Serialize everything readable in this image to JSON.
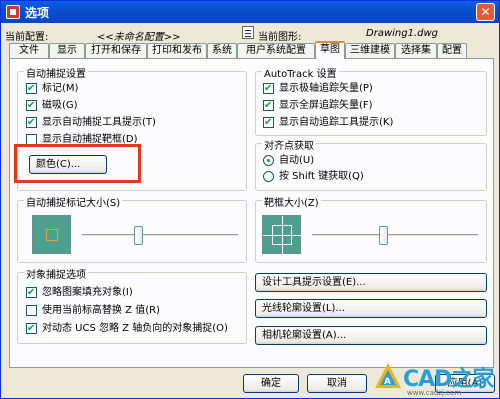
{
  "window": {
    "title": "选项",
    "close_glyph": "✕"
  },
  "config": {
    "current_config_label": "当前配置:",
    "current_config_value": "<<未命名配置>>",
    "current_drawing_label": "当前图形:",
    "current_drawing_value": "Drawing1.dwg"
  },
  "tabs": [
    {
      "label": "文件"
    },
    {
      "label": "显示"
    },
    {
      "label": "打开和保存"
    },
    {
      "label": "打印和发布"
    },
    {
      "label": "系统"
    },
    {
      "label": "用户系统配置"
    },
    {
      "label": "草图"
    },
    {
      "label": "三维建模"
    },
    {
      "label": "选择集"
    },
    {
      "label": "配置"
    }
  ],
  "autosnap": {
    "title": "自动捕捉设置",
    "options": [
      {
        "label": "标记(M)",
        "checked": true
      },
      {
        "label": "磁吸(G)",
        "checked": true
      },
      {
        "label": "显示自动捕捉工具提示(T)",
        "checked": true
      },
      {
        "label": "显示自动捕捉靶框(D)",
        "checked": false
      }
    ],
    "color_button": "颜色(C)..."
  },
  "autotrack": {
    "title": "AutoTrack 设置",
    "options": [
      {
        "label": "显示极轴追踪矢量(P)",
        "checked": true
      },
      {
        "label": "显示全屏追踪矢量(F)",
        "checked": true
      },
      {
        "label": "显示自动追踪工具提示(K)",
        "checked": true
      }
    ]
  },
  "alignment": {
    "title": "对齐点获取",
    "options": [
      {
        "label": "自动(U)",
        "selected": true
      },
      {
        "label": "按 Shift 键获取(Q)",
        "selected": false
      }
    ]
  },
  "marker_size": {
    "title": "自动捕捉标记大小(S)",
    "marker_color": "#e6a23a",
    "preview_bg": "#4f9f8f"
  },
  "aperture_size": {
    "title": "靶框大小(Z)"
  },
  "object_snap": {
    "title": "对象捕捉选项",
    "options": [
      {
        "label": "忽略图案填充对象(I)",
        "checked": true
      },
      {
        "label": "使用当前标高替换 Z 值(R)",
        "checked": false
      },
      {
        "label": "对动态 UCS 忽略 Z 轴负向的对象捕捉(O)",
        "checked": true
      }
    ]
  },
  "side_buttons": {
    "design_tooltip": "设计工具提示设置(E)...",
    "light_glyph": "光线轮廓设置(L)...",
    "camera_glyph": "相机轮廓设置(A)..."
  },
  "footer": {
    "ok": "确定",
    "cancel": "取消",
    "apply": "应用(A)"
  },
  "watermark": {
    "text": "CAD之家",
    "sub": "www.cadzj.com"
  },
  "colors": {
    "highlight": "#e2391a",
    "title_bar": "#0b4fd0"
  }
}
